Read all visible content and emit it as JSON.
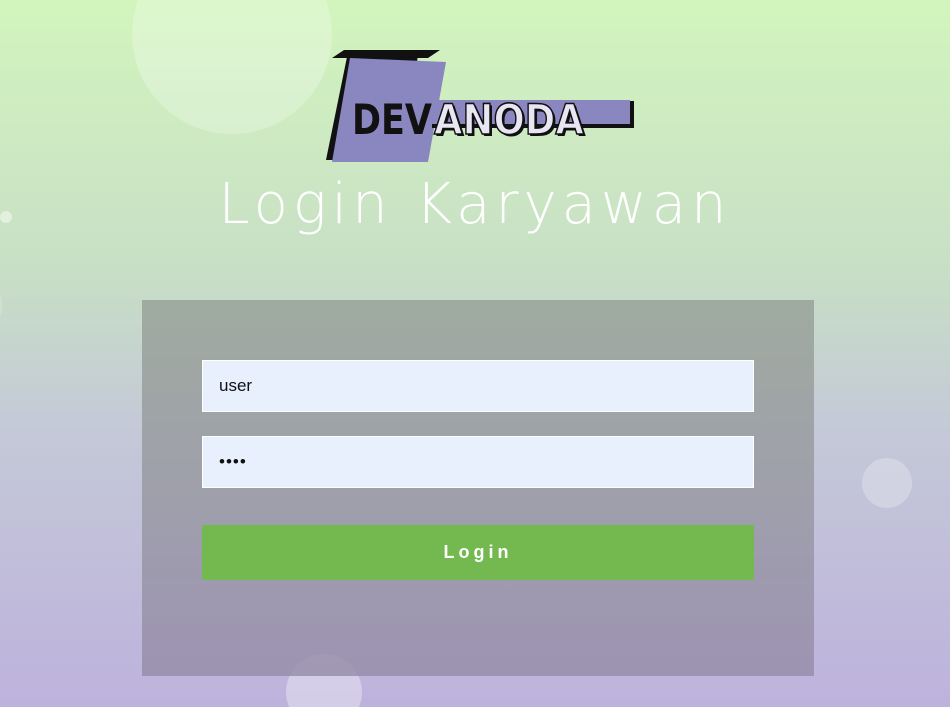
{
  "logo": {
    "part1": "DEV",
    "part2": "ANODA",
    "colors": {
      "accent": "#8a86c0",
      "dark": "#111111",
      "light": "#e8e6f2"
    }
  },
  "title": "Login Karyawan",
  "form": {
    "username": {
      "value": "user"
    },
    "password": {
      "value": "••••"
    },
    "login_label": "Login"
  },
  "colors": {
    "login_button": "#74b94f",
    "input_bg": "#e8f0fe",
    "bg_top": "#d2f5bd",
    "bg_bottom": "#bdb2dc"
  }
}
